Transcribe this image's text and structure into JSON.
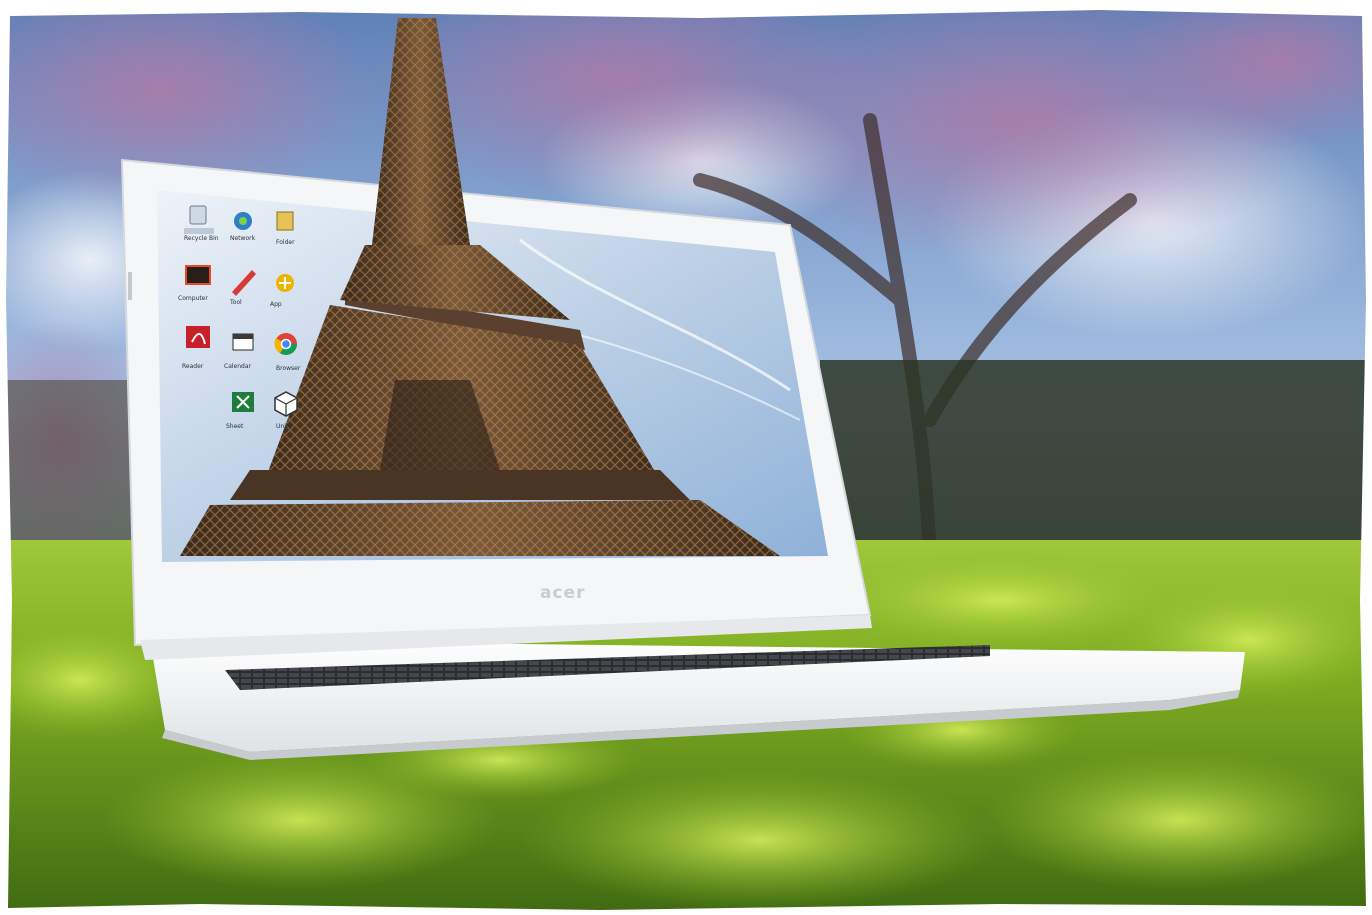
{
  "scene": {
    "description_colors": {
      "sky": "#8fb2de",
      "grass": "#8cbd2a",
      "laptop_body": "#f3f4f6",
      "tower": "#4a3424"
    }
  },
  "laptop": {
    "brand_logo": "acer"
  },
  "desktop": {
    "icons": [
      {
        "icon": "recycle-bin-icon",
        "label": "Recycle Bin"
      },
      {
        "icon": "network-icon",
        "label": "Network"
      },
      {
        "icon": "folder-icon",
        "label": "Folder"
      },
      {
        "icon": "monitor-icon",
        "label": "Computer"
      },
      {
        "icon": "pen-tool-icon",
        "label": "Tool"
      },
      {
        "icon": "app-launcher-icon",
        "label": "App"
      },
      {
        "icon": "pdf-reader-icon",
        "label": "Reader"
      },
      {
        "icon": "calendar-icon",
        "label": "Calendar"
      },
      {
        "icon": "chrome-icon",
        "label": "Browser"
      },
      {
        "icon": "spreadsheet-icon",
        "label": "Sheet"
      },
      {
        "icon": "unity-icon",
        "label": "Unity"
      }
    ]
  }
}
